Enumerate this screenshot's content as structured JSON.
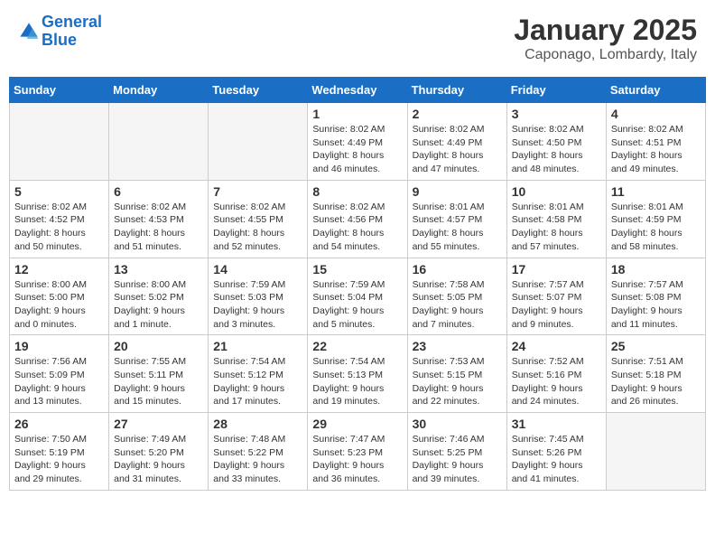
{
  "header": {
    "logo_line1": "General",
    "logo_line2": "Blue",
    "month": "January 2025",
    "location": "Caponago, Lombardy, Italy"
  },
  "weekdays": [
    "Sunday",
    "Monday",
    "Tuesday",
    "Wednesday",
    "Thursday",
    "Friday",
    "Saturday"
  ],
  "weeks": [
    [
      {
        "day": "",
        "info": ""
      },
      {
        "day": "",
        "info": ""
      },
      {
        "day": "",
        "info": ""
      },
      {
        "day": "1",
        "info": "Sunrise: 8:02 AM\nSunset: 4:49 PM\nDaylight: 8 hours and 46 minutes."
      },
      {
        "day": "2",
        "info": "Sunrise: 8:02 AM\nSunset: 4:49 PM\nDaylight: 8 hours and 47 minutes."
      },
      {
        "day": "3",
        "info": "Sunrise: 8:02 AM\nSunset: 4:50 PM\nDaylight: 8 hours and 48 minutes."
      },
      {
        "day": "4",
        "info": "Sunrise: 8:02 AM\nSunset: 4:51 PM\nDaylight: 8 hours and 49 minutes."
      }
    ],
    [
      {
        "day": "5",
        "info": "Sunrise: 8:02 AM\nSunset: 4:52 PM\nDaylight: 8 hours and 50 minutes."
      },
      {
        "day": "6",
        "info": "Sunrise: 8:02 AM\nSunset: 4:53 PM\nDaylight: 8 hours and 51 minutes."
      },
      {
        "day": "7",
        "info": "Sunrise: 8:02 AM\nSunset: 4:55 PM\nDaylight: 8 hours and 52 minutes."
      },
      {
        "day": "8",
        "info": "Sunrise: 8:02 AM\nSunset: 4:56 PM\nDaylight: 8 hours and 54 minutes."
      },
      {
        "day": "9",
        "info": "Sunrise: 8:01 AM\nSunset: 4:57 PM\nDaylight: 8 hours and 55 minutes."
      },
      {
        "day": "10",
        "info": "Sunrise: 8:01 AM\nSunset: 4:58 PM\nDaylight: 8 hours and 57 minutes."
      },
      {
        "day": "11",
        "info": "Sunrise: 8:01 AM\nSunset: 4:59 PM\nDaylight: 8 hours and 58 minutes."
      }
    ],
    [
      {
        "day": "12",
        "info": "Sunrise: 8:00 AM\nSunset: 5:00 PM\nDaylight: 9 hours and 0 minutes."
      },
      {
        "day": "13",
        "info": "Sunrise: 8:00 AM\nSunset: 5:02 PM\nDaylight: 9 hours and 1 minute."
      },
      {
        "day": "14",
        "info": "Sunrise: 7:59 AM\nSunset: 5:03 PM\nDaylight: 9 hours and 3 minutes."
      },
      {
        "day": "15",
        "info": "Sunrise: 7:59 AM\nSunset: 5:04 PM\nDaylight: 9 hours and 5 minutes."
      },
      {
        "day": "16",
        "info": "Sunrise: 7:58 AM\nSunset: 5:05 PM\nDaylight: 9 hours and 7 minutes."
      },
      {
        "day": "17",
        "info": "Sunrise: 7:57 AM\nSunset: 5:07 PM\nDaylight: 9 hours and 9 minutes."
      },
      {
        "day": "18",
        "info": "Sunrise: 7:57 AM\nSunset: 5:08 PM\nDaylight: 9 hours and 11 minutes."
      }
    ],
    [
      {
        "day": "19",
        "info": "Sunrise: 7:56 AM\nSunset: 5:09 PM\nDaylight: 9 hours and 13 minutes."
      },
      {
        "day": "20",
        "info": "Sunrise: 7:55 AM\nSunset: 5:11 PM\nDaylight: 9 hours and 15 minutes."
      },
      {
        "day": "21",
        "info": "Sunrise: 7:54 AM\nSunset: 5:12 PM\nDaylight: 9 hours and 17 minutes."
      },
      {
        "day": "22",
        "info": "Sunrise: 7:54 AM\nSunset: 5:13 PM\nDaylight: 9 hours and 19 minutes."
      },
      {
        "day": "23",
        "info": "Sunrise: 7:53 AM\nSunset: 5:15 PM\nDaylight: 9 hours and 22 minutes."
      },
      {
        "day": "24",
        "info": "Sunrise: 7:52 AM\nSunset: 5:16 PM\nDaylight: 9 hours and 24 minutes."
      },
      {
        "day": "25",
        "info": "Sunrise: 7:51 AM\nSunset: 5:18 PM\nDaylight: 9 hours and 26 minutes."
      }
    ],
    [
      {
        "day": "26",
        "info": "Sunrise: 7:50 AM\nSunset: 5:19 PM\nDaylight: 9 hours and 29 minutes."
      },
      {
        "day": "27",
        "info": "Sunrise: 7:49 AM\nSunset: 5:20 PM\nDaylight: 9 hours and 31 minutes."
      },
      {
        "day": "28",
        "info": "Sunrise: 7:48 AM\nSunset: 5:22 PM\nDaylight: 9 hours and 33 minutes."
      },
      {
        "day": "29",
        "info": "Sunrise: 7:47 AM\nSunset: 5:23 PM\nDaylight: 9 hours and 36 minutes."
      },
      {
        "day": "30",
        "info": "Sunrise: 7:46 AM\nSunset: 5:25 PM\nDaylight: 9 hours and 39 minutes."
      },
      {
        "day": "31",
        "info": "Sunrise: 7:45 AM\nSunset: 5:26 PM\nDaylight: 9 hours and 41 minutes."
      },
      {
        "day": "",
        "info": ""
      }
    ]
  ]
}
